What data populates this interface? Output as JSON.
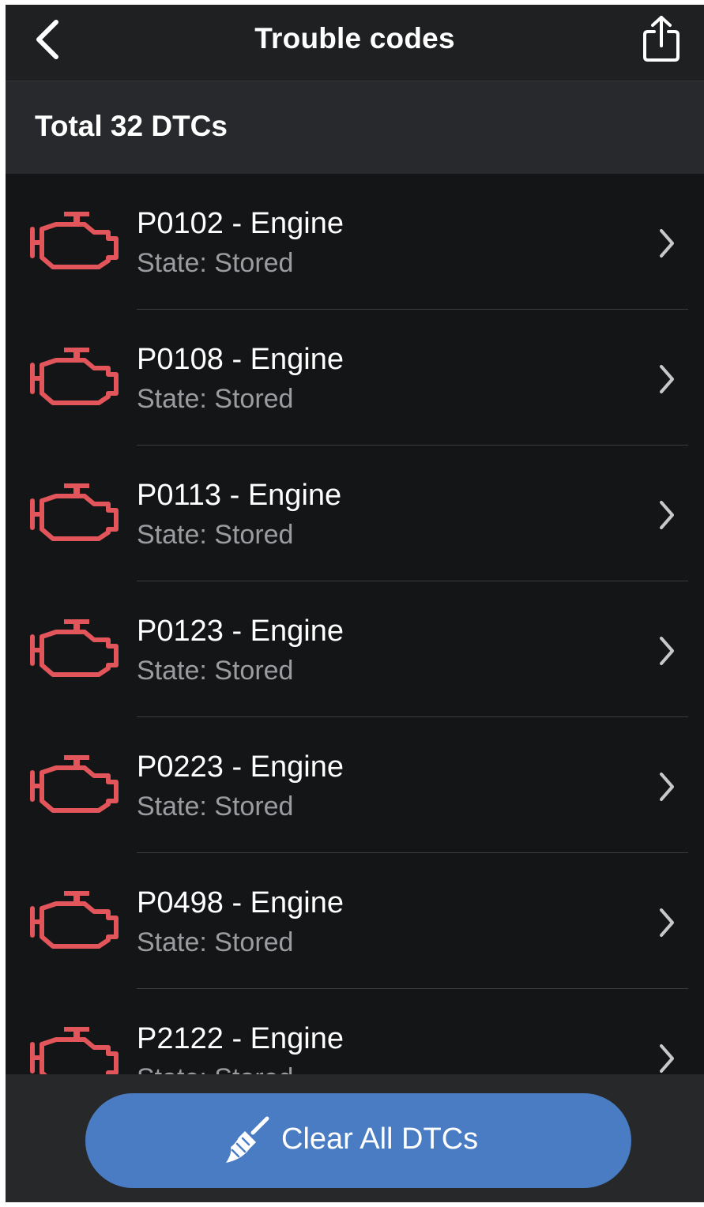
{
  "header": {
    "title": "Trouble codes",
    "back_icon": "chevron-left-icon",
    "share_icon": "share-icon"
  },
  "summary": {
    "label": "Total 32 DTCs"
  },
  "colors": {
    "engine_icon": "#e2555a",
    "button": "#4a7cc4",
    "background": "#141516"
  },
  "dtcs": [
    {
      "code": "P0102 - Engine",
      "state": "State: Stored"
    },
    {
      "code": "P0108 - Engine",
      "state": "State: Stored"
    },
    {
      "code": "P0113 - Engine",
      "state": "State: Stored"
    },
    {
      "code": "P0123 - Engine",
      "state": "State: Stored"
    },
    {
      "code": "P0223 - Engine",
      "state": "State: Stored"
    },
    {
      "code": "P0498 - Engine",
      "state": "State: Stored"
    },
    {
      "code": "P2122 - Engine",
      "state": "State: Stored"
    }
  ],
  "footer": {
    "button_label": "Clear All DTCs",
    "button_icon": "broom-icon"
  }
}
